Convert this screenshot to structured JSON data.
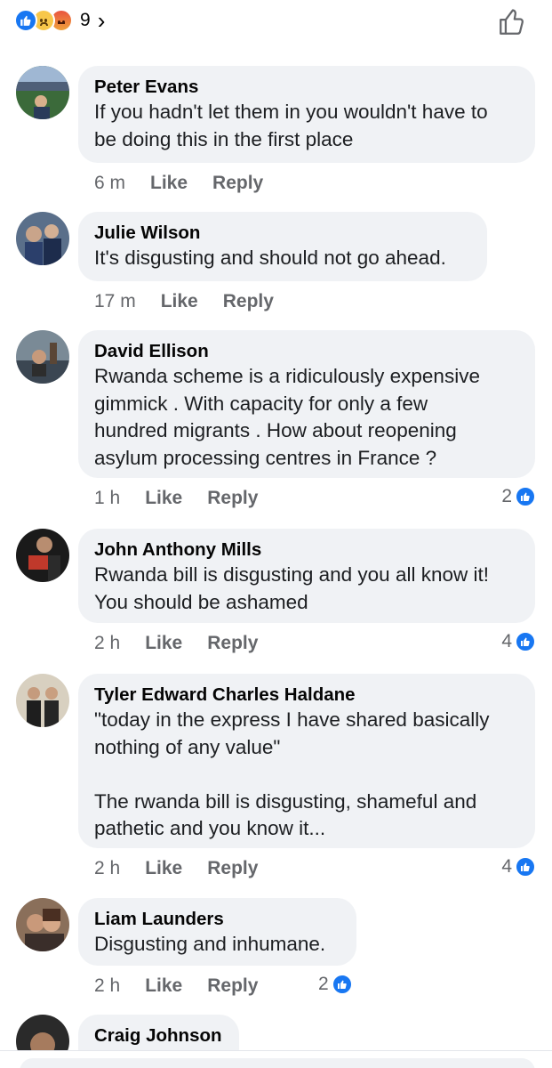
{
  "top_bar": {
    "reaction_count": "9",
    "reaction_icons": [
      "like-icon",
      "sad-icon",
      "angry-icon"
    ],
    "chevron": "›",
    "thumb_icon": "thumbs-up-outline-icon"
  },
  "colors": {
    "facebook_blue": "#1877f2",
    "bubble_bg": "#f0f2f5",
    "meta_text": "#65676b"
  },
  "comments": [
    {
      "name": "Peter Evans",
      "text": "If you hadn't let them in you wouldn't have to\nbe doing this in the first place",
      "time": "6 m",
      "like": "Like",
      "reply": "Reply",
      "likes": ""
    },
    {
      "name": "Julie Wilson",
      "text": "It's disgusting and should not go ahead.",
      "time": "17 m",
      "like": "Like",
      "reply": "Reply",
      "likes": ""
    },
    {
      "name": "David Ellison",
      "text": "Rwanda scheme is a ridiculously expensive\ngimmick  .  With capacity for only a few\nhundred migrants  .   How about reopening\nasylum processing centres in France ?",
      "time": "1 h",
      "like": "Like",
      "reply": "Reply",
      "likes": "2"
    },
    {
      "name": "John Anthony Mills",
      "text": "Rwanda bill is disgusting and you all know it!\nYou should be ashamed",
      "time": "2 h",
      "like": "Like",
      "reply": "Reply",
      "likes": "4"
    },
    {
      "name": "Tyler Edward Charles Haldane",
      "text": "\"today in the express I have shared basically\nnothing of any value\"\n\nThe rwanda bill is disgusting, shameful and\npathetic and you know it...",
      "time": "2 h",
      "like": "Like",
      "reply": "Reply",
      "likes": "4"
    },
    {
      "name": "Liam Launders",
      "text": "Disgusting and inhumane.",
      "time": "2 h",
      "like": "Like",
      "reply": "Reply",
      "likes": "2"
    },
    {
      "name": "Craig Johnson",
      "text": "",
      "time": "",
      "like": "",
      "reply": "",
      "likes": ""
    }
  ]
}
